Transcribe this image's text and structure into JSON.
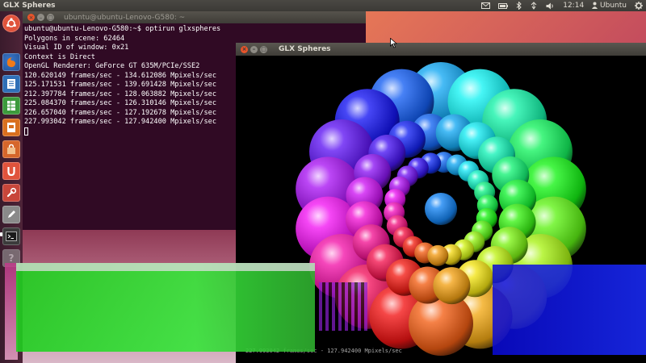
{
  "top_panel": {
    "title": "GLX Spheres",
    "time": "12:14",
    "user": "Ubuntu",
    "tray_icons": [
      "mail-icon",
      "battery-icon",
      "bluetooth-icon",
      "network-icon",
      "volume-icon",
      "gear-icon"
    ]
  },
  "launcher": {
    "items": [
      {
        "name": "dash-home",
        "icon": "ubuntu-logo-icon",
        "color": "#e0533c"
      },
      {
        "name": "firefox",
        "icon": "firefox-icon",
        "color": "#e66a21"
      },
      {
        "name": "writer",
        "icon": "document-icon",
        "color": "#2f6fb7"
      },
      {
        "name": "calc",
        "icon": "spreadsheet-icon",
        "color": "#3c9a3c"
      },
      {
        "name": "impress",
        "icon": "presentation-icon",
        "color": "#d9701f"
      },
      {
        "name": "software-center",
        "icon": "bag-icon",
        "color": "#d6662b"
      },
      {
        "name": "ubuntu-one",
        "icon": "ubuntu-one-icon",
        "color": "#e0533c"
      },
      {
        "name": "settings",
        "icon": "wrench-icon",
        "color": "#c8463a"
      },
      {
        "name": "text-editor",
        "icon": "pencil-icon",
        "color": "#8a8a8a"
      },
      {
        "name": "terminal",
        "icon": "terminal-icon",
        "color": "#3b3b3b"
      },
      {
        "name": "help",
        "icon": "help-icon",
        "color": "#9a9a9a"
      }
    ]
  },
  "terminal": {
    "title": "ubuntu@ubuntu-Lenovo-G580: ~",
    "lines": [
      "ubuntu@ubuntu-Lenovo-G580:~$ optirun glxspheres",
      "Polygons in scene: 62464",
      "Visual ID of window: 0x21",
      "Context is Direct",
      "OpenGL Renderer: GeForce GT 635M/PCIe/SSE2",
      "120.620149 frames/sec - 134.612086 Mpixels/sec",
      "125.171531 frames/sec - 139.691428 Mpixels/sec",
      "212.397784 frames/sec - 128.063882 Mpixels/sec",
      "225.084370 frames/sec - 126.310146 Mpixels/sec",
      "226.657040 frames/sec - 127.192678 Mpixels/sec",
      "227.993042 frames/sec - 127.942400 Mpixels/sec"
    ]
  },
  "glx_window": {
    "title": "GLX Spheres",
    "status": "227.993042 frames/sec - 127.942400 Mpixels/sec"
  }
}
